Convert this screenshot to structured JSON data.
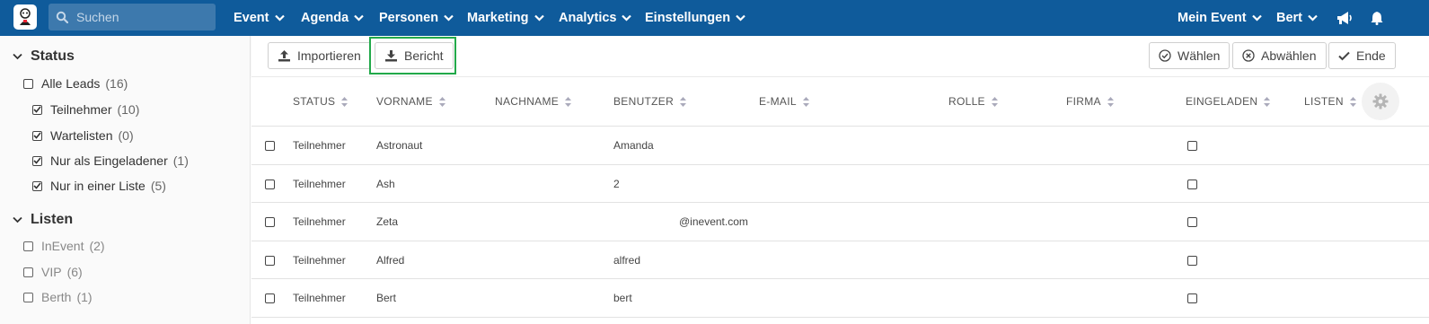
{
  "header": {
    "search_placeholder": "Suchen",
    "nav": [
      {
        "label": "Event"
      },
      {
        "label": "Agenda"
      },
      {
        "label": "Personen"
      },
      {
        "label": "Marketing"
      },
      {
        "label": "Analytics"
      },
      {
        "label": "Einstellungen"
      }
    ],
    "event_menu": "Mein Event",
    "user_menu": "Bert",
    "icons": [
      "megaphone-icon",
      "bell-icon"
    ]
  },
  "sidebar": {
    "status_title": "Status",
    "status_items": [
      {
        "label": "Alle Leads",
        "count": "(16)",
        "checked": false
      },
      {
        "label": "Teilnehmer",
        "count": "(10)",
        "checked": true
      },
      {
        "label": "Wartelisten",
        "count": "(0)",
        "checked": true
      },
      {
        "label": "Nur als Eingeladener",
        "count": "(1)",
        "checked": true
      },
      {
        "label": "Nur in einer Liste",
        "count": "(5)",
        "checked": true
      }
    ],
    "lists_title": "Listen",
    "list_items": [
      {
        "label": "InEvent",
        "count": "(2)"
      },
      {
        "label": "VIP",
        "count": "(6)"
      },
      {
        "label": "Berth",
        "count": "(1)"
      }
    ]
  },
  "toolbar": {
    "import_label": "Importieren",
    "report_label": "Bericht",
    "select_label": "Wählen",
    "deselect_label": "Abwählen",
    "end_label": "Ende"
  },
  "table": {
    "columns": [
      "STATUS",
      "VORNAME",
      "NACHNAME",
      "BENUTZER",
      "E-MAIL",
      "ROLLE",
      "FIRMA",
      "EINGELADEN",
      "LISTEN"
    ],
    "rows": [
      {
        "status": "Teilnehmer",
        "vorname": "Astronaut",
        "nachname": "",
        "benutzer": "Amanda",
        "email": ""
      },
      {
        "status": "Teilnehmer",
        "vorname": "Ash",
        "nachname": "",
        "benutzer": "2",
        "email": ""
      },
      {
        "status": "Teilnehmer",
        "vorname": "Zeta",
        "nachname": "",
        "benutzer": "",
        "email": "@inevent.com"
      },
      {
        "status": "Teilnehmer",
        "vorname": "Alfred",
        "nachname": "",
        "benutzer": "alfred",
        "email": ""
      },
      {
        "status": "Teilnehmer",
        "vorname": "Bert",
        "nachname": "",
        "benutzer": "bert",
        "email": ""
      }
    ]
  },
  "colors": {
    "nav_bg": "#0f5b9b",
    "highlight": "#22a94a"
  }
}
